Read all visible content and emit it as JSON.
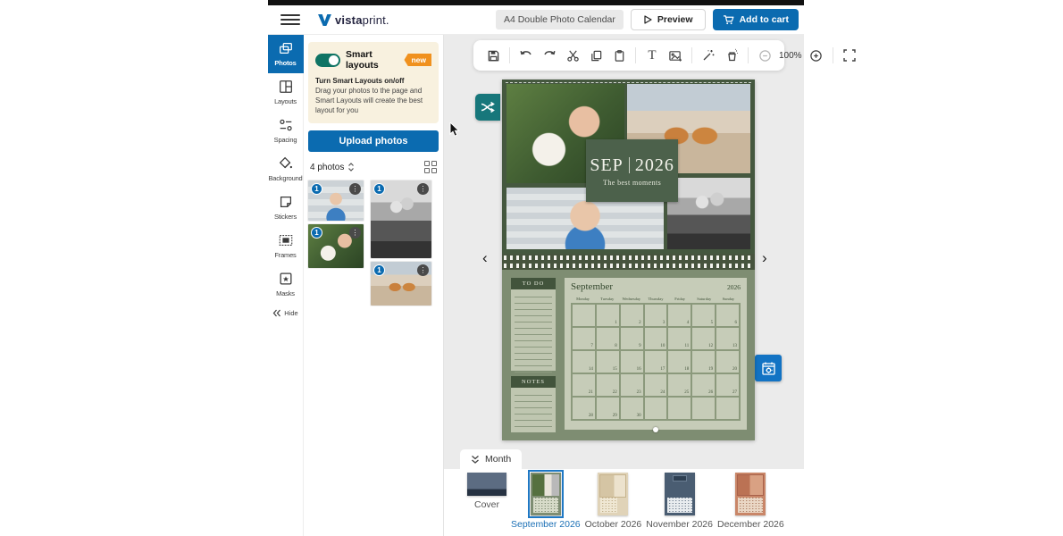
{
  "header": {
    "brand_bold": "vista",
    "brand_regular": "print.",
    "product_title": "A4 Double Photo Calendar",
    "preview_label": "Preview",
    "add_to_cart_label": "Add to cart"
  },
  "sidebar": {
    "items": [
      {
        "label": "Photos",
        "active": true
      },
      {
        "label": "Layouts"
      },
      {
        "label": "Spacing"
      },
      {
        "label": "Background"
      },
      {
        "label": "Stickers"
      },
      {
        "label": "Frames"
      },
      {
        "label": "Masks"
      }
    ],
    "hide_label": "Hide"
  },
  "panel": {
    "smart_layouts_label": "Smart layouts",
    "new_badge": "new",
    "tooltip_title": "Turn Smart Layouts on/off",
    "tooltip_body": "Drag your photos to the page and Smart Layouts will create the best layout for you",
    "upload_button": "Upload photos",
    "photo_count": "4 photos",
    "photos": [
      {
        "name": "girl-ice-cream",
        "badge": "1"
      },
      {
        "name": "boy-with-dog",
        "badge": "1"
      },
      {
        "name": "couple-black-white",
        "badge": "1"
      },
      {
        "name": "corgis-on-beach",
        "badge": "1"
      }
    ]
  },
  "toolbar": {
    "zoom_level": "100%"
  },
  "calendar": {
    "month_short": "SEP",
    "year": "2026",
    "tagline": "The best moments",
    "month_name": "September",
    "grid_year": "2026",
    "todo_label": "TO DO",
    "notes_label": "NOTES",
    "todo_line_count": 13,
    "notes_line_count": 6,
    "weekdays": [
      "Monday",
      "Tuesday",
      "Wednesday",
      "Thursday",
      "Friday",
      "Saturday",
      "Sunday"
    ],
    "weeks": [
      [
        "",
        "1",
        "2",
        "3",
        "4",
        "5",
        "6"
      ],
      [
        "7",
        "8",
        "9",
        "10",
        "11",
        "12",
        "13"
      ],
      [
        "14",
        "15",
        "16",
        "17",
        "18",
        "19",
        "20"
      ],
      [
        "21",
        "22",
        "23",
        "24",
        "25",
        "26",
        "27"
      ],
      [
        "28",
        "29",
        "30",
        "",
        "",
        "",
        ""
      ]
    ]
  },
  "filmstrip": {
    "tab_label": "Month",
    "pages": [
      {
        "label": "Cover",
        "variant": "cover",
        "selected": false
      },
      {
        "label": "September 2026",
        "variant": "september",
        "selected": true
      },
      {
        "label": "October 2026",
        "variant": "october",
        "selected": false
      },
      {
        "label": "November 2026",
        "variant": "november",
        "selected": false
      },
      {
        "label": "December 2026",
        "variant": "december",
        "selected": false
      }
    ]
  },
  "colors": {
    "accent_blue": "#0b6bb0",
    "toggle_teal": "#0f7464",
    "badge_orange": "#f0911e",
    "page_green": "#7e8d72",
    "page_dark_green": "#45583f",
    "shuffle_teal": "#17777b"
  }
}
